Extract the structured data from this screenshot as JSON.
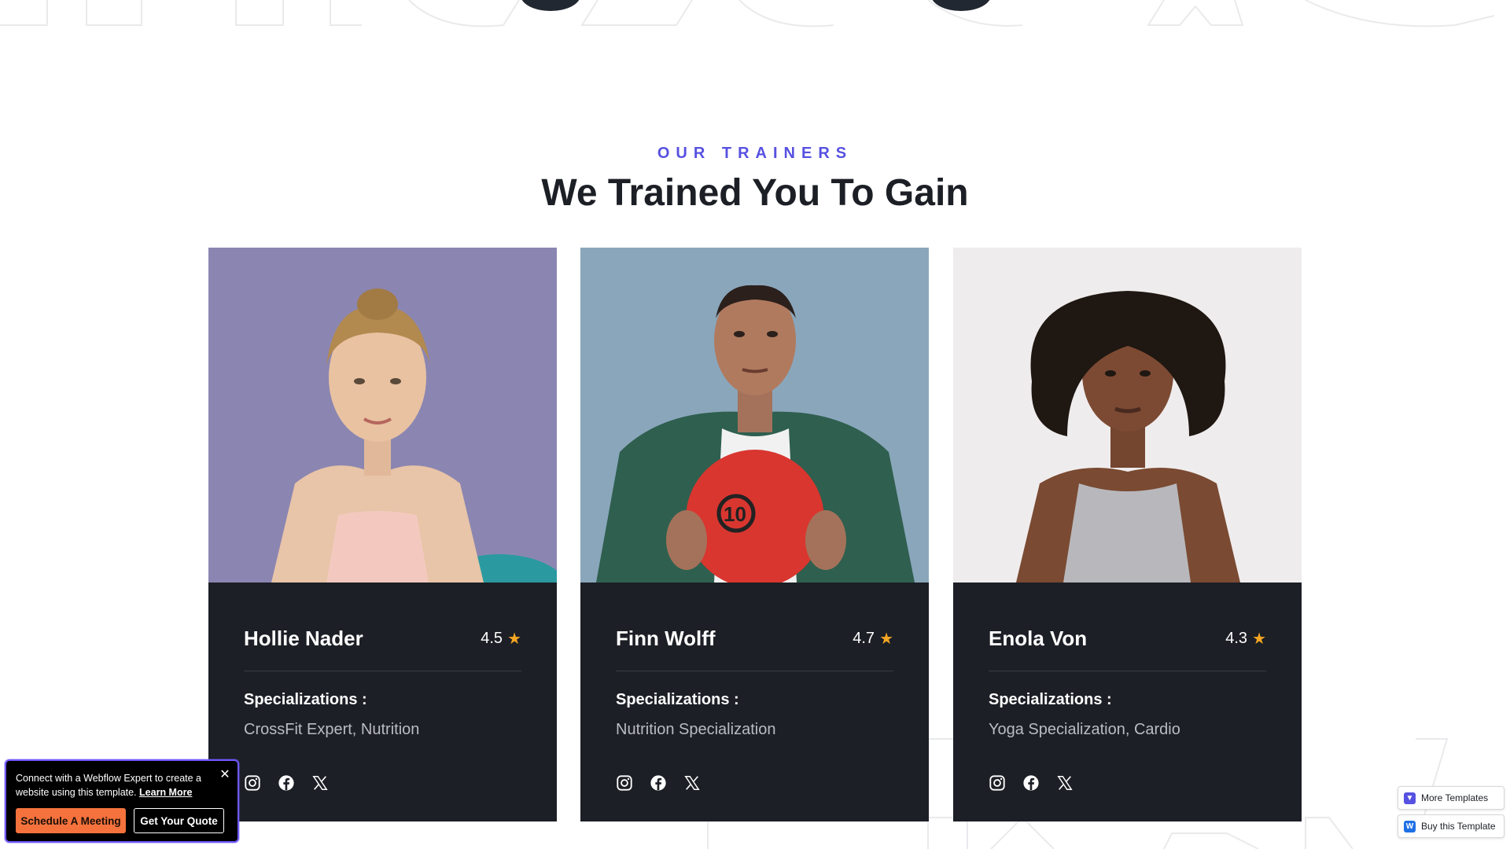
{
  "section": {
    "eyebrow": "OUR TRAINERS",
    "heading": "We Trained You To Gain"
  },
  "trainers": [
    {
      "name": "Hollie Nader",
      "rating": "4.5",
      "spec_label": "Specializations :",
      "spec_value": "CrossFit Expert, Nutrition"
    },
    {
      "name": "Finn Wolff",
      "rating": "4.7",
      "spec_label": "Specializations :",
      "spec_value": "Nutrition Specialization"
    },
    {
      "name": "Enola Von",
      "rating": "4.3",
      "spec_label": "Specializations :",
      "spec_value": "Yoga Specialization, Cardio"
    }
  ],
  "icons": {
    "rating": "star-icon",
    "socials": [
      "instagram-icon",
      "facebook-icon",
      "x-twitter-icon"
    ]
  },
  "promo": {
    "text": "Connect with a Webflow Expert to create a website using this template.",
    "link": "Learn More",
    "close": "✕",
    "primary_button": "Schedule A Meeting",
    "secondary_button": "Get Your Quote"
  },
  "badges": {
    "more_templates": "More Templates",
    "buy_template": "Buy this Template"
  },
  "colors": {
    "accent": "#5751e1",
    "card_bg": "#1c1f25",
    "star": "#f6a623",
    "promo_button": "#f5723d",
    "promo_border": "#6f58ff"
  }
}
